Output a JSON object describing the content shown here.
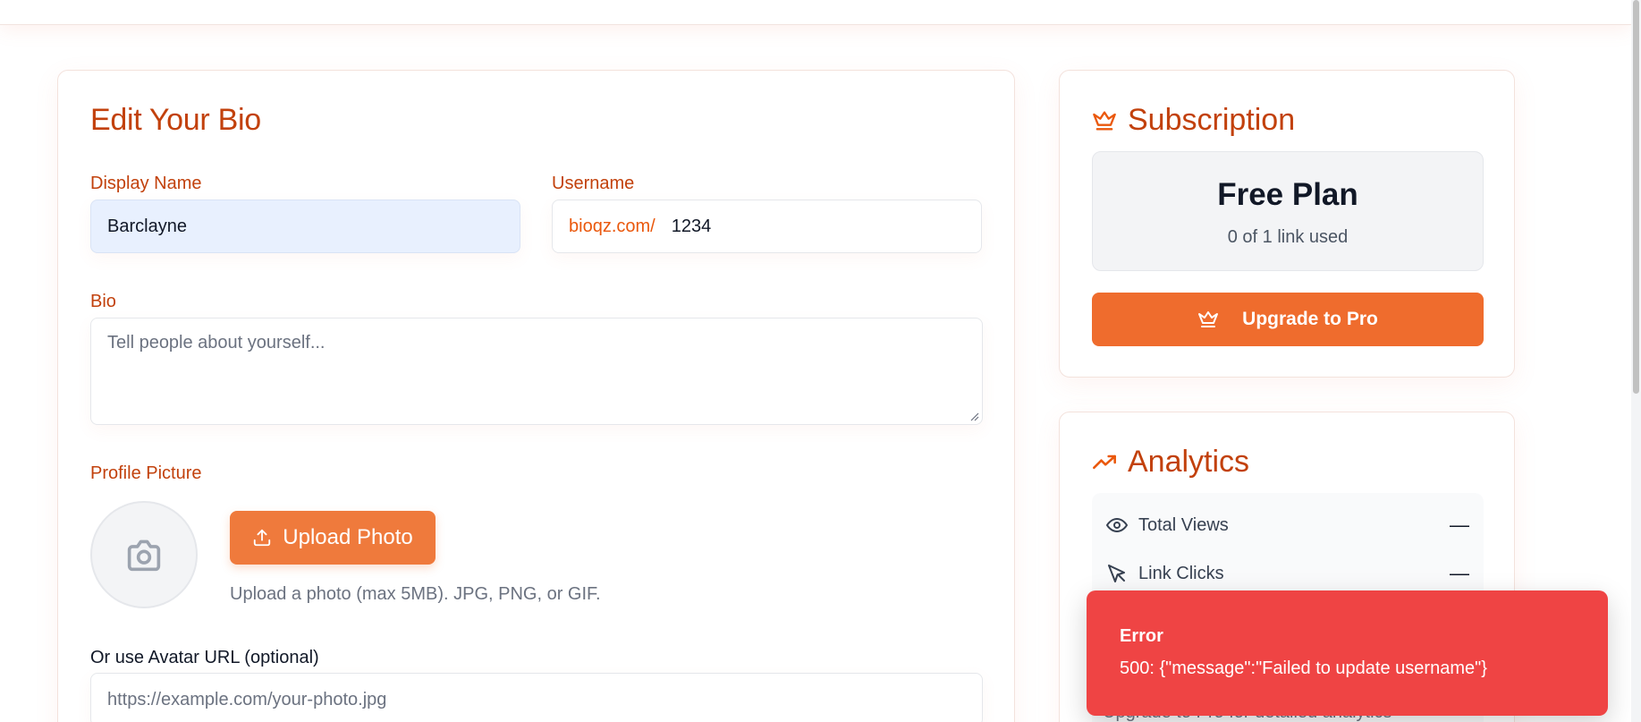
{
  "edit": {
    "title": "Edit Your Bio",
    "display_name": {
      "label": "Display Name",
      "value": "Barclayne"
    },
    "username": {
      "label": "Username",
      "prefix": "bioqz.com/",
      "value": "1234"
    },
    "bio": {
      "label": "Bio",
      "placeholder": "Tell people about yourself..."
    },
    "profile_picture": {
      "label": "Profile Picture",
      "upload_label": "Upload Photo",
      "helper": "Upload a photo (max 5MB). JPG, PNG, or GIF."
    },
    "avatar_url": {
      "label": "Or use Avatar URL (optional)",
      "placeholder": "https://example.com/your-photo.jpg"
    }
  },
  "subscription": {
    "title": "Subscription",
    "plan_name": "Free Plan",
    "usage": "0 of 1 link used",
    "upgrade_label": "Upgrade to Pro"
  },
  "analytics": {
    "title": "Analytics",
    "stats": [
      {
        "label": "Total Views",
        "value": "—",
        "icon": "eye-icon"
      },
      {
        "label": "Link Clicks",
        "value": "—",
        "icon": "cursor-icon"
      }
    ],
    "footer": "Upgrade to Pro for detailed analytics"
  },
  "toast": {
    "title": "Error",
    "message": "500: {\"message\":\"Failed to update username\"}"
  },
  "colors": {
    "accent": "#c2410c",
    "button": "#ef6c2d",
    "error": "#ef4444"
  }
}
